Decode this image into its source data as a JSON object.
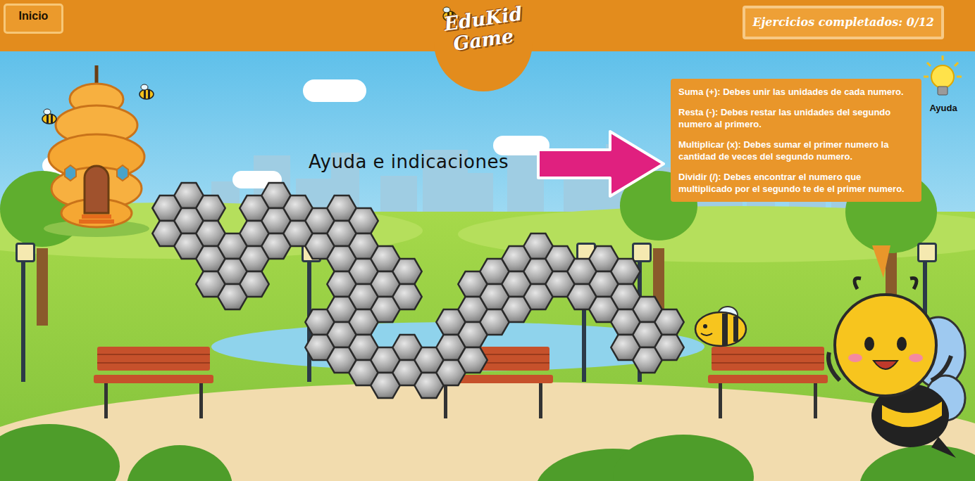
{
  "header": {
    "home_button": {
      "label": "Inicio"
    },
    "logo": {
      "line1": "EduKid",
      "line2": "Game"
    },
    "progress": {
      "label": "Ejercicios completados: 0/12"
    }
  },
  "main": {
    "title": "Ayuda e indicaciones"
  },
  "help": {
    "button_label": "Ayuda",
    "tips": [
      "Suma (+): Debes unir las unidades de cada numero.",
      "Resta (-): Debes restar las unidades del segundo numero al primero.",
      "Multiplicar (x): Debes sumar el primer numero la cantidad de veces del segundo numero.",
      "Dividir (/): Debes encontrar el numero que multiplicado por el segundo te de el primer numero."
    ]
  }
}
